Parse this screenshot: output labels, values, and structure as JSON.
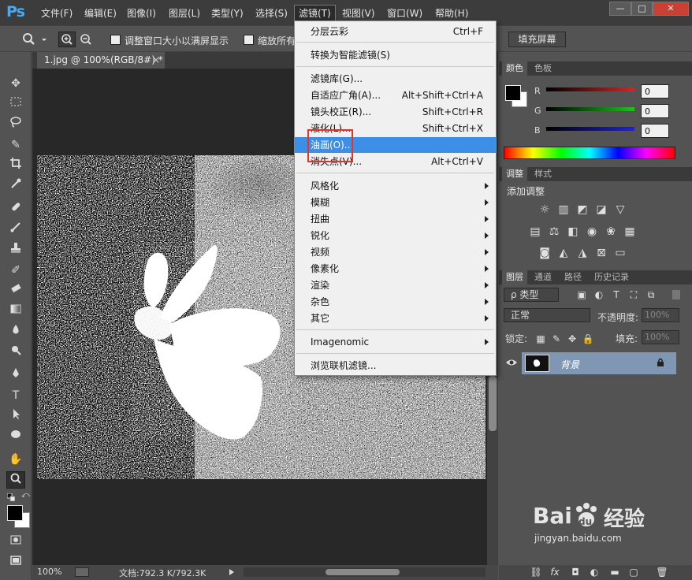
{
  "app": {
    "logo": "Ps",
    "menu": [
      "文件(F)",
      "编辑(E)",
      "图像(I)",
      "图层(L)",
      "类型(Y)",
      "选择(S)",
      "滤镜(T)",
      "视图(V)",
      "窗口(W)",
      "帮助(H)"
    ],
    "active_menu": "滤镜(T)",
    "window_controls": {
      "minimize": "—",
      "restore": "□",
      "close": "✕"
    }
  },
  "options_bar": {
    "resize_windows_label": "调整窗口大小以满屏显示",
    "zoom_all_label": "缩放所有窗",
    "fill_screen_label": "填充屏幕"
  },
  "document": {
    "tab_title": "1.jpg @ 100%(RGB/8#) *",
    "tab_close": "×",
    "zoom": "100%",
    "doc_size": "文档:792.3 K/792.3K"
  },
  "filter_menu": {
    "items": [
      {
        "label": "分层云彩",
        "shortcut": "Ctrl+F"
      },
      {
        "label": "转换为智能滤镜(S)",
        "shortcut": ""
      },
      {
        "label": "滤镜库(G)...",
        "shortcut": ""
      },
      {
        "label": "自适应广角(A)...",
        "shortcut": "Alt+Shift+Ctrl+A"
      },
      {
        "label": "镜头校正(R)...",
        "shortcut": "Shift+Ctrl+R"
      },
      {
        "label": "液化(L)...",
        "shortcut": "Shift+Ctrl+X"
      },
      {
        "label": "油画(O)...",
        "shortcut": "",
        "highlighted": true
      },
      {
        "label": "消失点(V)...",
        "shortcut": "Alt+Ctrl+V"
      },
      {
        "label": "风格化",
        "submenu": true
      },
      {
        "label": "模糊",
        "submenu": true
      },
      {
        "label": "扭曲",
        "submenu": true
      },
      {
        "label": "锐化",
        "submenu": true
      },
      {
        "label": "视频",
        "submenu": true
      },
      {
        "label": "像素化",
        "submenu": true
      },
      {
        "label": "渲染",
        "submenu": true
      },
      {
        "label": "杂色",
        "submenu": true
      },
      {
        "label": "其它",
        "submenu": true
      },
      {
        "label": "Imagenomic",
        "submenu": true
      },
      {
        "label": "浏览联机滤镜...",
        "shortcut": ""
      }
    ],
    "highlight_color": "#3d8ee6",
    "annotation_color": "#e0352a"
  },
  "color_panel": {
    "tabs": [
      "颜色",
      "色板"
    ],
    "channels": [
      {
        "label": "R",
        "value": "0",
        "color": "#e02020"
      },
      {
        "label": "G",
        "value": "0",
        "color": "#20c020"
      },
      {
        "label": "B",
        "value": "0",
        "color": "#2020e0"
      }
    ]
  },
  "adjustments_panel": {
    "tabs": [
      "调整",
      "样式"
    ],
    "title": "添加调整"
  },
  "layers_panel": {
    "tabs": [
      "图层",
      "通道",
      "路径",
      "历史记录"
    ],
    "filter_kind": "ρ 类型",
    "blend_mode": "正常",
    "opacity_label": "不透明度:",
    "opacity_value": "100%",
    "lock_label": "锁定:",
    "fill_label": "填充:",
    "fill_value": "100%",
    "layers": [
      {
        "name": "背景",
        "visible": true,
        "locked": true
      }
    ]
  },
  "watermark": {
    "brand": "Bai",
    "paw": "du",
    "cn": "经验",
    "url": "jingyan.baidu.com"
  }
}
